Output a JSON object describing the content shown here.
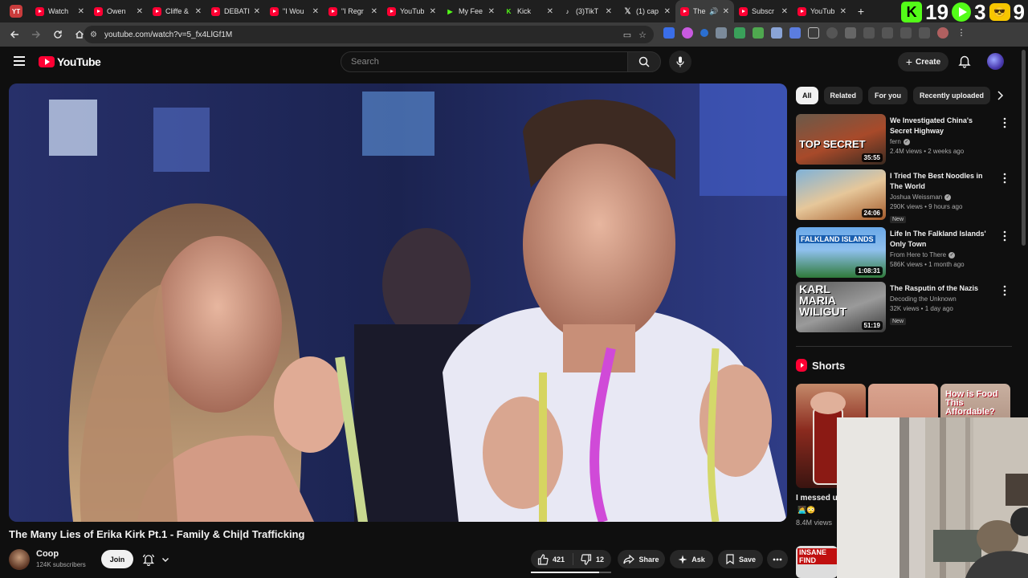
{
  "browser": {
    "app_badge": "YT",
    "tabs": [
      {
        "title": "Watch",
        "icon": "yt"
      },
      {
        "title": "Owen",
        "icon": "yt"
      },
      {
        "title": "Cliffe &",
        "icon": "yt"
      },
      {
        "title": "DEBATI",
        "icon": "yt"
      },
      {
        "title": "\"I Wou",
        "icon": "yt"
      },
      {
        "title": "\"I Regr",
        "icon": "yt"
      },
      {
        "title": "YouTub",
        "icon": "yt"
      },
      {
        "title": "My Fee",
        "icon": "play"
      },
      {
        "title": "Kick",
        "icon": "kick"
      },
      {
        "title": "(3)TikT",
        "icon": "tt"
      },
      {
        "title": "(1) cap",
        "icon": "x"
      },
      {
        "title": "The",
        "icon": "yt",
        "active": true
      },
      {
        "title": "Subscr",
        "icon": "yt"
      },
      {
        "title": "YouTub",
        "icon": "yt"
      }
    ],
    "new_tab": "+",
    "overlay": {
      "k_count": "19",
      "play_count": "3",
      "yt_count": "9",
      "k_label": "K"
    },
    "url": "youtube.com/watch?v=5_fx4LlGf1M"
  },
  "youtube": {
    "logo_text": "YouTube",
    "search_placeholder": "Search",
    "create_label": "Create",
    "create_plus": "+"
  },
  "video": {
    "title": "The Many Lies of Erika Kirk Pt.1 - Family & Chi|d Trafficking",
    "channel": "Coop",
    "subscribers": "124K subscribers",
    "join_label": "Join",
    "likes": "421",
    "dislikes": "12",
    "share_label": "Share",
    "ask_label": "Ask",
    "save_label": "Save",
    "like_bar_fraction": 0.85
  },
  "sidebar": {
    "chips": [
      {
        "label": "All",
        "selected": true
      },
      {
        "label": "Related"
      },
      {
        "label": "For you"
      },
      {
        "label": "Recently uploaded"
      }
    ],
    "recommendations": [
      {
        "title": "We Investigated China's Secret Highway",
        "channel": "fern",
        "verified": true,
        "views": "2.4M views • 2 weeks ago",
        "duration": "35:55",
        "thumb_text": "TOP SECRET",
        "new": false
      },
      {
        "title": "I Tried The Best Noodles in The World",
        "channel": "Joshua Weissman",
        "verified": true,
        "views": "290K views • 9 hours ago",
        "duration": "24:06",
        "thumb_text": "",
        "new": true
      },
      {
        "title": "Life In The Falkland Islands' Only Town",
        "channel": "From Here to There",
        "verified": true,
        "views": "586K views • 1 month ago",
        "duration": "1:08:31",
        "thumb_text": "FALKLAND ISLANDS",
        "new": false
      },
      {
        "title": "The Rasputin of the Nazis",
        "channel": "Decoding the Unknown",
        "verified": false,
        "views": "32K views • 1 day ago",
        "duration": "51:19",
        "thumb_text": "KARL MARIA WILIGUT",
        "new": true
      }
    ],
    "new_badge": "New",
    "shorts_heading": "Shorts",
    "shorts": [
      {
        "title": "I messed u",
        "emoji": "🧑‍💻😳",
        "views": "8.4M views"
      },
      {
        "title": "",
        "emoji": "",
        "views": ""
      },
      {
        "title": "",
        "emoji": "",
        "views": "",
        "thumb_text": "How is Food This Affordable?"
      }
    ],
    "short2_thumb_text": "INSANE FIND"
  },
  "colors": {
    "background": "#0f0f0f",
    "youtube_red": "#ff0033",
    "kick_green": "#53fc18",
    "chip_bg": "#272727"
  }
}
